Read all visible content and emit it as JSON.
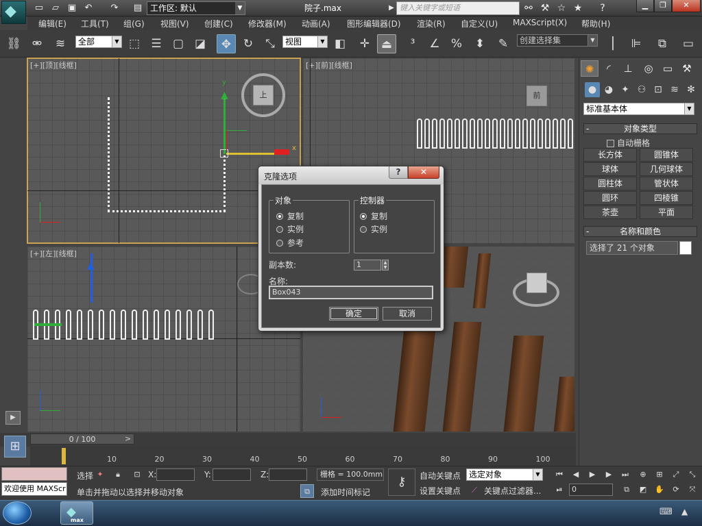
{
  "app": {
    "workspace_label": "工作区: 默认",
    "doc_title": "院子.max",
    "search_placeholder": "键入关键字或短语",
    "taskbar_app_label": "max"
  },
  "menu": [
    "编辑(E)",
    "工具(T)",
    "组(G)",
    "视图(V)",
    "创建(C)",
    "修改器(M)",
    "动画(A)",
    "图形编辑器(D)",
    "渲染(R)",
    "自定义(U)",
    "MAXScript(X)",
    "帮助(H)"
  ],
  "toolbar": {
    "selection_filter": "全部",
    "coord_system": "视图",
    "named_selection": "创建选择集"
  },
  "viewports": {
    "top": "[+][顶][线框]",
    "front": "[+][前][线框]",
    "left": "[+][左][线框]",
    "top_axis_x": "x",
    "top_axis_y": "y",
    "viewcube_top": "上",
    "viewcube_front": "前"
  },
  "command_panel": {
    "category": "标准基本体",
    "object_type_title": "对象类型",
    "auto_grid": "自动栅格",
    "object_buttons": [
      "长方体",
      "圆锥体",
      "球体",
      "几何球体",
      "圆柱体",
      "管状体",
      "圆环",
      "四棱锥",
      "茶壶",
      "平面"
    ],
    "name_color_title": "名称和颜色",
    "selection_info": "选择了 21 个对象"
  },
  "dialog": {
    "title": "克隆选项",
    "help_label": "?",
    "close_label": "✕",
    "object_group": "对象",
    "object_options": [
      "复制",
      "实例",
      "参考"
    ],
    "object_selected": 0,
    "controller_group": "控制器",
    "controller_options": [
      "复制",
      "实例"
    ],
    "controller_selected": 0,
    "copies_label": "副本数:",
    "copies_value": "1",
    "name_label": "名称:",
    "name_value": "Box043",
    "ok_label": "确定",
    "cancel_label": "取消"
  },
  "timeline": {
    "slider_text": "0 / 100",
    "ticks": [
      "10",
      "20",
      "30",
      "40",
      "50",
      "60",
      "70",
      "80",
      "90",
      "100"
    ]
  },
  "status": {
    "welcome": "欢迎使用 MAXScr",
    "selected_label": "选择",
    "x_label": "X:",
    "y_label": "Y:",
    "z_label": "Z:",
    "grid": "栅格 = 100.0mm",
    "prompt": "单击并拖动以选择并移动对象",
    "add_time_tag": "添加时间标记",
    "auto_key": "自动关键点",
    "set_key": "设置关键点",
    "key_mode": "选定对象",
    "key_filters": "关键点过滤器...",
    "frame_value": "0"
  },
  "colors": {
    "viewport_bg": "#595959",
    "selected_viewport_border": "#caa451",
    "accent": "#5a88b5",
    "close_button": "#c8432a",
    "gizmo_y": "#2fae3a",
    "gizmo_x": "#e02020"
  }
}
